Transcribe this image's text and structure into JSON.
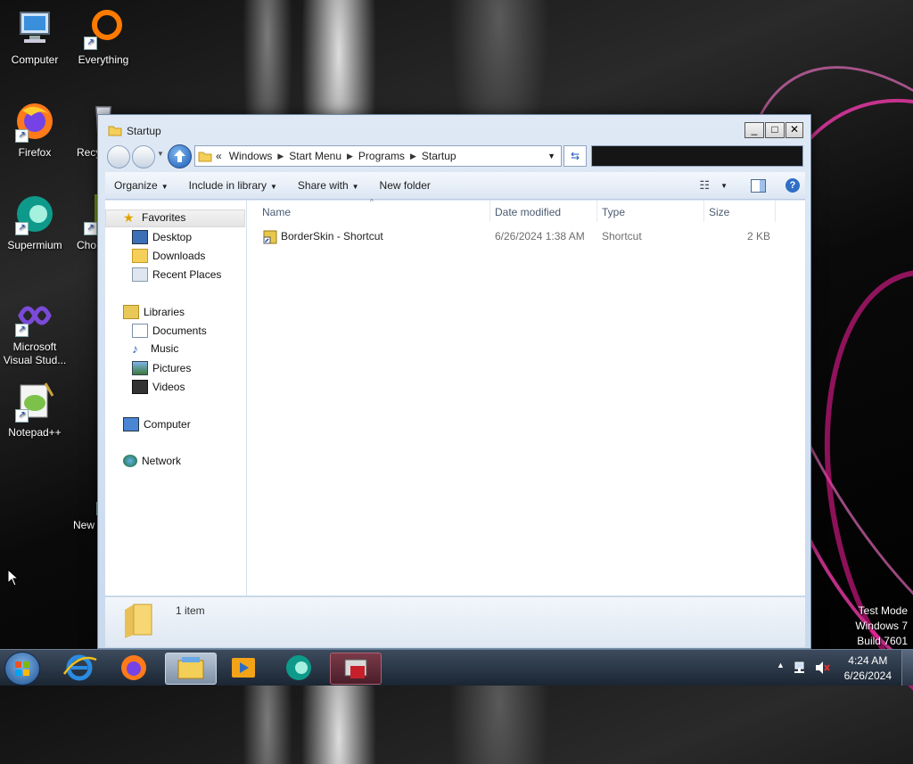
{
  "desktop": {
    "icons": [
      {
        "label": "Computer",
        "icon": "computer-icon"
      },
      {
        "label": "Everything",
        "icon": "everything-icon"
      },
      {
        "label": "Firefox",
        "icon": "firefox-icon"
      },
      {
        "label": "Recy",
        "icon": "recycle-bin-icon"
      },
      {
        "label": "Supermium",
        "icon": "supermium-icon"
      },
      {
        "label": "Cho",
        "icon": "chocolatey-icon"
      },
      {
        "label": "Microsoft Visual Stud...",
        "icon": "visual-studio-icon"
      },
      {
        "label": "Notepad++",
        "icon": "notepadpp-icon"
      },
      {
        "label": "New",
        "icon": "new-file-icon"
      }
    ],
    "watermark": {
      "line1": "Test Mode",
      "line2": "Windows 7",
      "line3": "Build 7601"
    }
  },
  "window": {
    "title": "Startup",
    "controls": {
      "minimize": "_",
      "maximize": "□",
      "close": "✕"
    },
    "address": {
      "overflow": "«",
      "crumbs": [
        "Windows",
        "Start Menu",
        "Programs",
        "Startup"
      ]
    },
    "toolbar": {
      "organize": "Organize",
      "include_in_library": "Include in library",
      "share_with": "Share with",
      "new_folder": "New folder"
    },
    "nav": {
      "favorites": "Favorites",
      "desktop": "Desktop",
      "downloads": "Downloads",
      "recent_places": "Recent Places",
      "libraries": "Libraries",
      "documents": "Documents",
      "music": "Music",
      "pictures": "Pictures",
      "videos": "Videos",
      "computer": "Computer",
      "network": "Network"
    },
    "columns": {
      "name": "Name",
      "date_modified": "Date modified",
      "type": "Type",
      "size": "Size"
    },
    "files": [
      {
        "name": "BorderSkin - Shortcut",
        "date_modified": "6/26/2024 1:38 AM",
        "type": "Shortcut",
        "size": "2 KB"
      }
    ],
    "details": {
      "count": "1 item"
    }
  },
  "taskbar": {
    "items": [
      "start-orb",
      "internet-explorer",
      "firefox",
      "windows-explorer",
      "media-player",
      "supermium",
      "active-app"
    ],
    "clock": {
      "time": "4:24 AM",
      "date": "6/26/2024"
    }
  },
  "colors": {
    "accent": "#1b5ab5",
    "taskbar": "#1b2633",
    "pink": "#ff3fb4"
  }
}
